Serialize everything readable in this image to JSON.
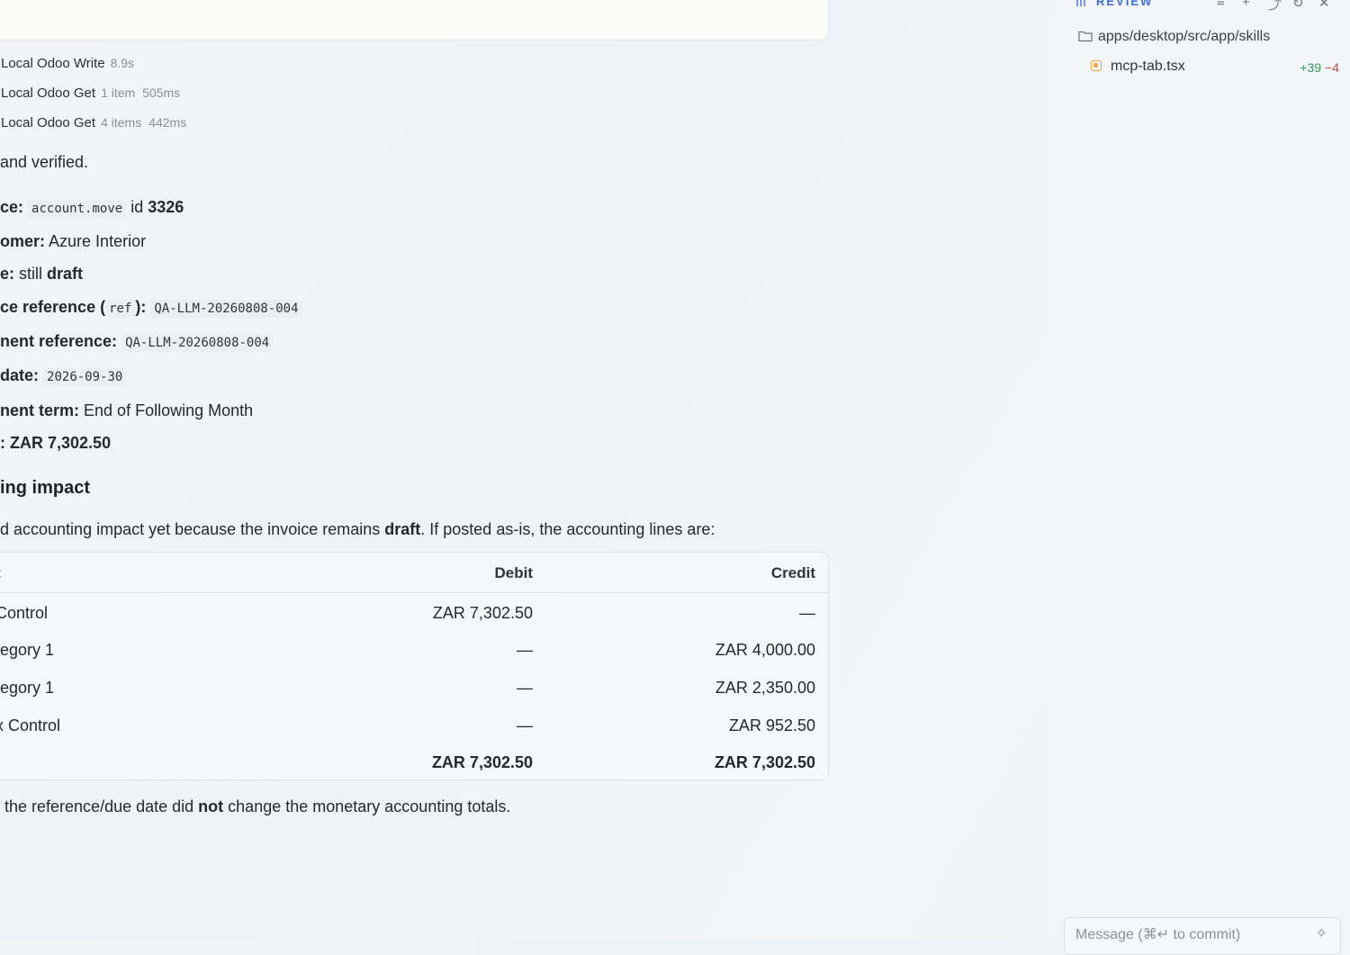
{
  "tool_calls": [
    {
      "name": "Local Odoo Write",
      "meta": [
        "8.9s"
      ]
    },
    {
      "name": "Local Odoo Get",
      "meta": [
        "1 item",
        "505ms"
      ]
    },
    {
      "name": "Local Odoo Get",
      "meta": [
        "4 items",
        "442ms"
      ]
    }
  ],
  "summary": {
    "intro": "and verified.",
    "invoice_label": "ce:",
    "invoice_model": "account.move",
    "invoice_id_prefix": "id",
    "invoice_id": "3326",
    "customer_label": "omer:",
    "customer_value": "Azure Interior",
    "state_label": "e:",
    "state_prefix": "still",
    "state_value": "draft",
    "ref_label_a": "ce reference (",
    "ref_code": "ref",
    "ref_label_b": "):",
    "ref_value": "QA-LLM-20260808-004",
    "payment_ref_label": "nent reference:",
    "payment_ref_value": "QA-LLM-20260808-004",
    "due_label": "date:",
    "due_value": "2026-09-30",
    "term_label": "nent term:",
    "term_value": "End of Following Month",
    "total_label": ":",
    "total_value": "ZAR 7,302.50"
  },
  "impact": {
    "heading": "ing impact",
    "para_a": "d accounting impact yet because the invoice remains",
    "para_bold": "draft",
    "para_b": ". If posted as-is, the accounting lines are:"
  },
  "table": {
    "headers": {
      "account": "t",
      "debit": "Debit",
      "credit": "Credit"
    },
    "rows": [
      {
        "account": "Control",
        "debit": "ZAR 7,302.50",
        "credit": "—"
      },
      {
        "account": "ategory 1",
        "debit": "—",
        "credit": "ZAR 4,000.00"
      },
      {
        "account": "ategory 1",
        "debit": "—",
        "credit": "ZAR 2,350.00"
      },
      {
        "account": "ax Control",
        "debit": "—",
        "credit": "ZAR 952.50"
      }
    ],
    "totals": {
      "debit": "ZAR 7,302.50",
      "credit": "ZAR 7,302.50"
    }
  },
  "footer_note": {
    "a": "the reference/due date did",
    "bold": "not",
    "b": "change the monetary accounting totals."
  },
  "sidebar": {
    "title": "REVIEW",
    "folder_path": "apps/desktop/src/app/skills",
    "file_name": "mcp-tab.tsx",
    "additions": "+39",
    "deletions": "−4",
    "message_placeholder": "Message (⌘↵ to commit)"
  },
  "icons": [
    "grid-icon",
    "list-icon",
    "plus-icon",
    "branch-icon",
    "refresh-icon",
    "close-icon",
    "folder-icon",
    "file-modified-icon",
    "sparkle-icon"
  ],
  "colors": {
    "accent": "#3b6fe0",
    "add": "#3a9a5b",
    "delete": "#d14b4b",
    "modified": "#f0a530"
  }
}
